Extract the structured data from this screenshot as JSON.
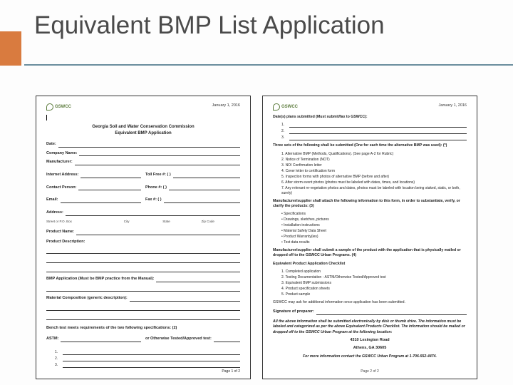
{
  "title": "Equivalent BMP List Application",
  "date": "January 1, 2016",
  "logo": "GSWCC",
  "page1": {
    "form_title_1": "Georgia Soil and Water Conservation Commission",
    "form_title_2": "Equivalent BMP Application",
    "labels": {
      "date": "Date:",
      "company": "Company Name:",
      "manufacturer": "Manufacturer:",
      "internet": "Internet Address:",
      "tollfree": "Toll Free #: (        )",
      "contact": "Contact Person:",
      "phone": "Phone #: (        )",
      "email": "Email:",
      "fax": "Fax #: (        )",
      "address": "Address:",
      "sub_street": "Street or P.O. Box",
      "sub_city": "City",
      "sub_state": "State",
      "sub_zip": "Zip Code",
      "product_name": "Product Name:",
      "product_desc": "Product Description:",
      "bmp_app": "BMP Application (Must be BMP practice from the Manual):",
      "material": "Material Composition (generic description):",
      "bench": "Bench test meets requirements of the two following specifications: (2)",
      "astm": "ASTM:",
      "or": "or  Otherwise Tested/Approved test:"
    },
    "footer": "Page 1 of 2"
  },
  "page2": {
    "dates_heading": "Date(s) plans submitted (Must submit/fax to GSWCC):",
    "three_sets": "Three sets of the following shall be submitted (One for each time the alternative BMP was used): (*)",
    "three_sets_items": [
      "Alternative BMP (Methods, Qualifications). (See page A-2 for Rubric)",
      "Notice of Termination (NOT)",
      "NOI Confirmation letter",
      "Cover letter to certification form",
      "Inspection forms with photos of alternative BMP (before and after)",
      "After storm event photos (photos must be labeled with dates, times, and locations)",
      "Any relevant re-vegetation photos and dates, photos must be labeled with location being staked, static, or both, surely)"
    ],
    "attach_heading": "Manufacturer/supplier shall attach the following information to this form, in order to substantiate, verify, or clarify the products: (3)",
    "attach_items": [
      "Specifications",
      "Drawings, sketches, pictures",
      "Installation instructions",
      "Material Safety Data Sheet",
      "Product Warranty(ies)",
      "Test data results"
    ],
    "sample_heading": "Manufacturer/supplier shall submit a sample of the product with the application that is physically mailed or dropped off to the GSWCC Urban Programs. (4)",
    "checklist_heading": "Equivalent Product Application Checklist",
    "checklist_items": [
      "Completed application",
      "Testing Documentation - ASTM/Otherwise Tested/Approved test",
      "Equivalent BMP submissions",
      "Product specification sheets",
      "Product sample"
    ],
    "ask_line": "GSWCC may ask for additional information once application has been submitted.",
    "sig_label": "Signature of preparer:",
    "footer_note": "All the above information shall be submitted electronically by disk or thumb drive. The information must be labeled and categorized as per the above Equivalent Products Checklist. The information should be mailed or dropped off to the GSWCC Urban Program at the following location:",
    "addr1": "4310 Lexington Road",
    "addr2": "Athens, GA 30605",
    "more_info": "For more information contact the GSWCC Urban Program at 1-706-552-4474.",
    "footer": "Page 2 of 2"
  }
}
